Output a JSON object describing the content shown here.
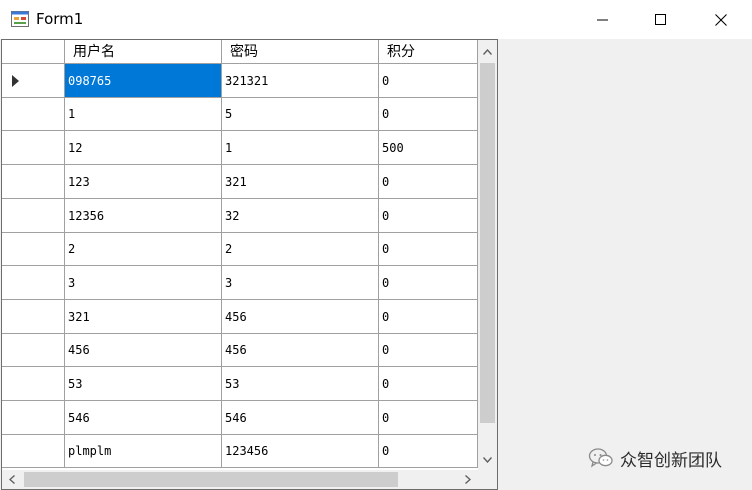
{
  "window": {
    "title": "Form1",
    "icon": "winforms-app-icon",
    "controls": [
      "minimize-icon",
      "maximize-icon",
      "close-icon"
    ]
  },
  "grid": {
    "columns": [
      "用户名",
      "密码",
      "积分"
    ],
    "selected_row": 0,
    "rows": [
      [
        "098765",
        "321321",
        "0"
      ],
      [
        "1",
        "5",
        "0"
      ],
      [
        "12",
        "1",
        "500"
      ],
      [
        "123",
        "321",
        "0"
      ],
      [
        "12356",
        "32",
        "0"
      ],
      [
        "2",
        "2",
        "0"
      ],
      [
        "3",
        "3",
        "0"
      ],
      [
        "321",
        "456",
        "0"
      ],
      [
        "456",
        "456",
        "0"
      ],
      [
        "53",
        "53",
        "0"
      ],
      [
        "546",
        "546",
        "0"
      ],
      [
        "plmplm",
        "123456",
        "0"
      ]
    ]
  },
  "watermark": {
    "text": "众智创新团队",
    "icon": "wechat-icon"
  },
  "colors": {
    "selection": "#0078d7",
    "grid_lines": "#a0a0a0",
    "background": "#f0f0f0"
  }
}
